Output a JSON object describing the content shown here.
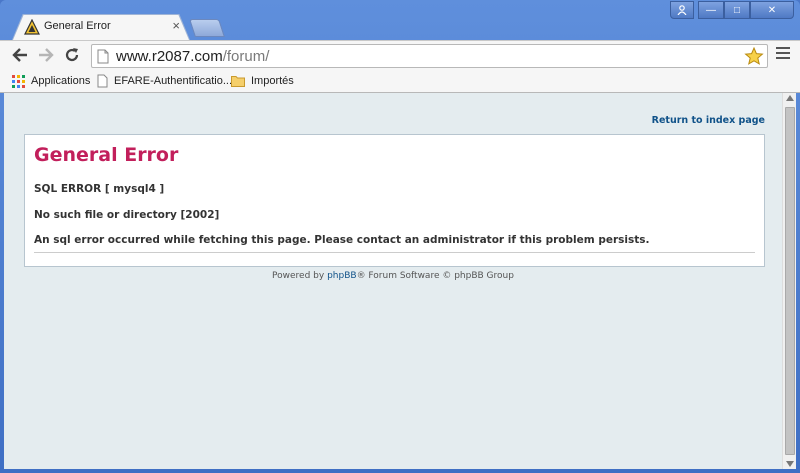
{
  "browser": {
    "tab": {
      "title": "General Error",
      "close_glyph": "×"
    },
    "window_controls": {
      "user": "user-icon",
      "minimize": "—",
      "maximize": "□",
      "close": "✕"
    },
    "url": {
      "host": "www.r2087.com",
      "path": "/forum/"
    },
    "bookmarks": [
      {
        "label": "Applications",
        "icon": "apps-grid-icon"
      },
      {
        "label": "EFARE-Authentificatio...",
        "icon": "page-icon"
      },
      {
        "label": "Importés",
        "icon": "folder-icon"
      }
    ]
  },
  "page": {
    "return_link": "Return to index page",
    "error_title": "General Error",
    "messages": [
      "SQL ERROR [ mysql4 ]",
      "No such file or directory [2002]",
      "An sql error occurred while fetching this page. Please contact an administrator if this problem persists."
    ],
    "footer": {
      "prefix": "Powered by ",
      "link": "phpBB",
      "suffix": "® Forum Software © phpBB Group"
    }
  },
  "colors": {
    "title": "#c21f5b",
    "link": "#105289",
    "page_bg": "#e4ecef"
  }
}
